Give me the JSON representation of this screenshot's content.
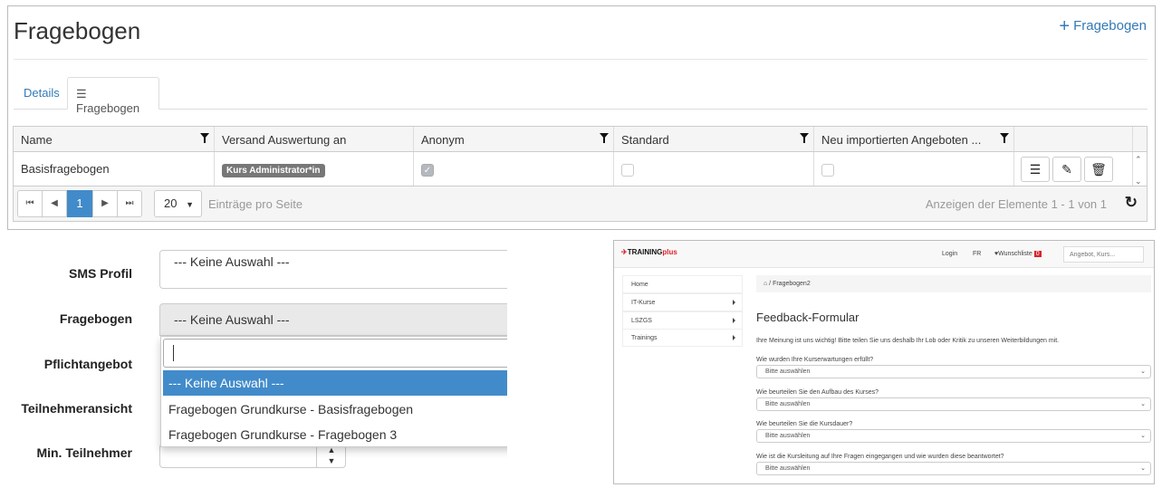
{
  "admin": {
    "title": "Fragebogen",
    "add_label": "Fragebogen",
    "tabs": [
      {
        "label": "Details"
      },
      {
        "label": "Fragebogen"
      }
    ],
    "columns": [
      "Name",
      "Versand Auswertung an",
      "Anonym",
      "Standard",
      "Neu importierten Angeboten ..."
    ],
    "rows": [
      {
        "name": "Basisfragebogen",
        "versand": "Kurs Administrator*in",
        "anonym": true,
        "standard": false,
        "neu": false
      }
    ],
    "pager": {
      "current": "1",
      "page_size": "20",
      "page_size_label": "Einträge pro Seite",
      "info": "Anzeigen der Elemente 1 - 1 von 1"
    }
  },
  "form": {
    "labels": [
      "SMS Profil",
      "Fragebogen",
      "Pflichtangebot",
      "Teilnehmeransicht",
      "Min. Teilnehmer"
    ],
    "sms_value": "--- Keine Auswahl ---",
    "fragebogen_value": "--- Keine Auswahl ---",
    "options": [
      "--- Keine Auswahl ---",
      "Fragebogen Grundkurse - Basisfragebogen",
      "Fragebogen Grundkurse - Fragebogen 3"
    ],
    "search_value": ""
  },
  "preview": {
    "logo": "TRAININGplus",
    "nav": {
      "login": "Login",
      "lang": "FR",
      "wishlist": "Wunschliste",
      "wishlist_count": "0",
      "search_placeholder": "Angebot, Kurs..."
    },
    "sidebar": [
      "Home",
      "IT-Kurse",
      "LSZGS",
      "Trainings"
    ],
    "breadcrumb": "Fragebogen2",
    "title": "Feedback-Formular",
    "intro": "Ihre Meinung ist uns wichtig! Bitte teilen Sie uns deshalb Ihr Lob oder Kritik zu unseren Weiterbildungen mit.",
    "questions": [
      {
        "q": "Wie wurden Ihre Kurserwartungen erfüllt?",
        "a": "Bitte auswählen"
      },
      {
        "q": "Wie beurteilen Sie den Aufbau des Kurses?",
        "a": "Bitte auswählen"
      },
      {
        "q": "Wie beurteilen Sie die Kursdauer?",
        "a": "Bitte auswählen"
      },
      {
        "q": "Wie ist die Kursleitung auf Ihre Fragen eingegangen und wie wurden diese beantwortet?",
        "a": "Bitte auswählen"
      }
    ]
  },
  "colors": {
    "accent": "#337ab7",
    "selected": "#428bca",
    "brand_red": "#d9232d"
  }
}
